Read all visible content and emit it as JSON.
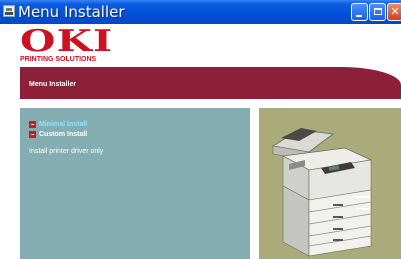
{
  "window": {
    "title": "Menu Installer"
  },
  "brand": {
    "logo": "OKI",
    "tagline": "PRINTING SOLUTIONS"
  },
  "header": {
    "label": "Menu Installer"
  },
  "options": [
    {
      "label": "Minimal Install"
    },
    {
      "label": "Custom Install"
    }
  ],
  "description": "Install printer driver only",
  "colors": {
    "brand_red": "#cc1222",
    "banner": "#8b2038",
    "panel": "#84adb2",
    "photo_bg": "#aaab7a",
    "highlight": "#8fe2ff"
  },
  "icons": [
    "app-icon",
    "minimize-icon",
    "maximize-icon",
    "close-icon",
    "bullet-icon"
  ]
}
